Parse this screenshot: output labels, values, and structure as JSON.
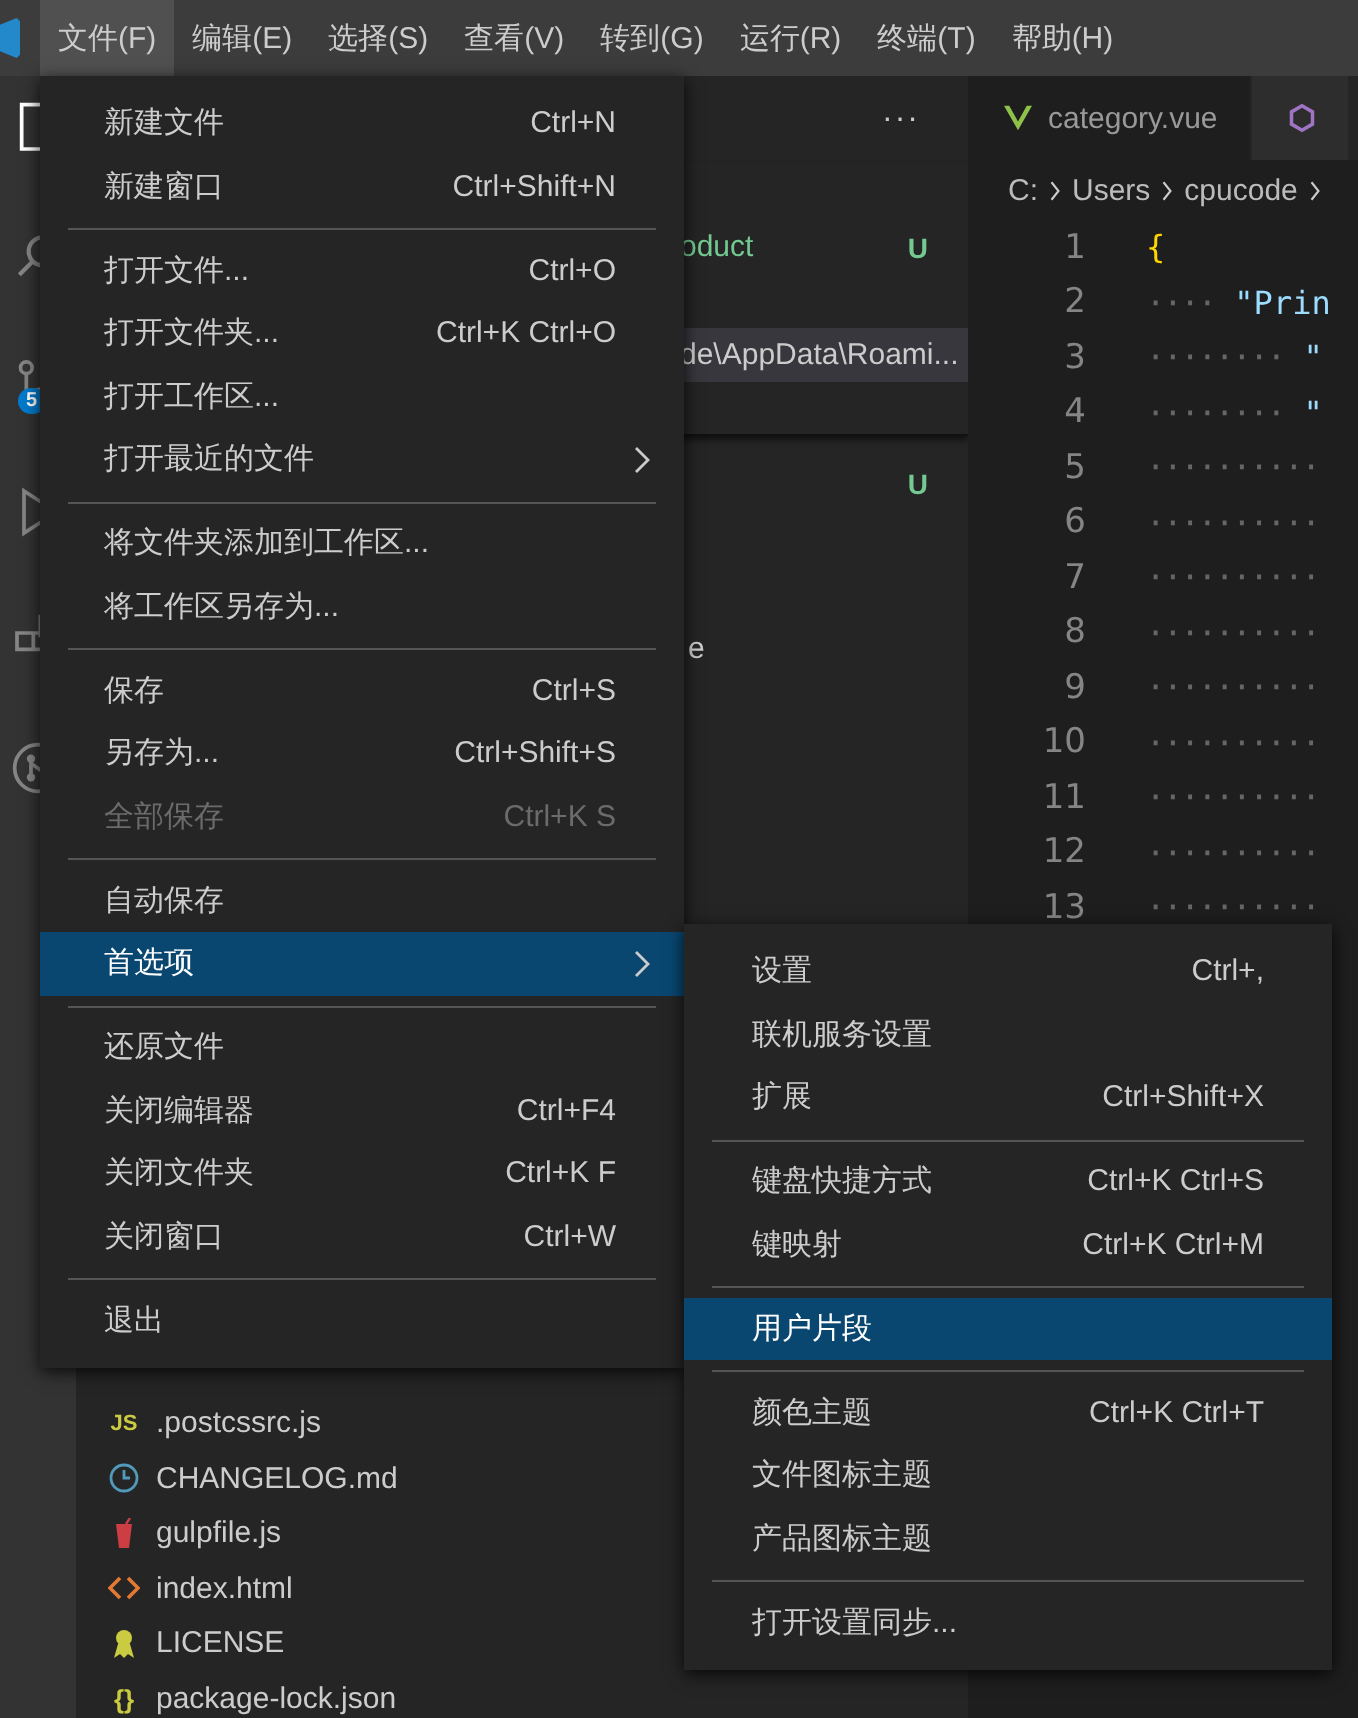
{
  "menubar": [
    {
      "label": "文件(F)",
      "selected": true
    },
    {
      "label": "编辑(E)",
      "selected": false
    },
    {
      "label": "选择(S)",
      "selected": false
    },
    {
      "label": "查看(V)",
      "selected": false
    },
    {
      "label": "转到(G)",
      "selected": false
    },
    {
      "label": "运行(R)",
      "selected": false
    },
    {
      "label": "终端(T)",
      "selected": false
    },
    {
      "label": "帮助(H)",
      "selected": false
    }
  ],
  "activity_bar": {
    "source_control_badge": "5"
  },
  "sidebar": {
    "more": "···",
    "open_editors": [
      {
        "text": "oduct",
        "status": "U",
        "selected": false
      },
      {
        "text": "de\\AppData\\Roami...",
        "selected": true
      }
    ],
    "folder_rows": [
      {
        "status": "U"
      },
      {
        "text": "e"
      }
    ],
    "files": [
      {
        "name": ".postcssrc.js",
        "kind": "js",
        "icon": "JS"
      },
      {
        "name": "CHANGELOG.md",
        "kind": "changelog"
      },
      {
        "name": "gulpfile.js",
        "kind": "gulp"
      },
      {
        "name": "index.html",
        "kind": "html"
      },
      {
        "name": "LICENSE",
        "kind": "license"
      },
      {
        "name": "package-lock.json",
        "kind": "json",
        "icon": "{}"
      }
    ]
  },
  "editor": {
    "tabs": [
      {
        "label": "category.vue",
        "kind": "vue",
        "selected": true
      },
      {
        "kind": "style",
        "selected": false
      }
    ],
    "breadcrumb": [
      "C:",
      "Users",
      "cpucode"
    ],
    "lines": [
      {
        "number": "1",
        "code": "{"
      },
      {
        "number": "2",
        "whitespace": "····",
        "code": "\"Prin"
      },
      {
        "number": "3",
        "whitespace": "········",
        "code": "\""
      },
      {
        "number": "4",
        "whitespace": "········",
        "code": "\""
      },
      {
        "number": "5",
        "whitespace": "··········"
      },
      {
        "number": "6",
        "whitespace": "··········"
      },
      {
        "number": "7",
        "whitespace": "··········"
      },
      {
        "number": "8",
        "whitespace": "··········"
      },
      {
        "number": "9",
        "whitespace": "··········"
      },
      {
        "number": "10",
        "whitespace": "··········"
      },
      {
        "number": "11",
        "whitespace": "··········"
      },
      {
        "number": "12",
        "whitespace": "··········"
      },
      {
        "number": "13",
        "whitespace": "··········"
      }
    ]
  },
  "file_menu": [
    {
      "kind": "item",
      "label": "新建文件",
      "shortcut": "Ctrl+N",
      "selected": false,
      "disabled": false
    },
    {
      "kind": "item",
      "label": "新建窗口",
      "shortcut": "Ctrl+Shift+N",
      "selected": false,
      "disabled": false
    },
    {
      "kind": "separator"
    },
    {
      "kind": "item",
      "label": "打开文件...",
      "shortcut": "Ctrl+O",
      "selected": false,
      "disabled": false
    },
    {
      "kind": "item",
      "label": "打开文件夹...",
      "shortcut": "Ctrl+K Ctrl+O",
      "selected": false,
      "disabled": false
    },
    {
      "kind": "item",
      "label": "打开工作区...",
      "selected": false,
      "disabled": false
    },
    {
      "kind": "submenu",
      "label": "打开最近的文件",
      "selected": false,
      "disabled": false
    },
    {
      "kind": "separator"
    },
    {
      "kind": "item",
      "label": "将文件夹添加到工作区...",
      "selected": false,
      "disabled": false
    },
    {
      "kind": "item",
      "label": "将工作区另存为...",
      "selected": false,
      "disabled": false
    },
    {
      "kind": "separator"
    },
    {
      "kind": "item",
      "label": "保存",
      "shortcut": "Ctrl+S",
      "selected": false,
      "disabled": false
    },
    {
      "kind": "item",
      "label": "另存为...",
      "shortcut": "Ctrl+Shift+S",
      "selected": false,
      "disabled": false
    },
    {
      "kind": "item",
      "label": "全部保存",
      "shortcut": "Ctrl+K S",
      "selected": false,
      "disabled": true
    },
    {
      "kind": "separator"
    },
    {
      "kind": "item",
      "label": "自动保存",
      "selected": false,
      "disabled": false
    },
    {
      "kind": "submenu",
      "label": "首选项",
      "selected": true,
      "disabled": false
    },
    {
      "kind": "separator"
    },
    {
      "kind": "item",
      "label": "还原文件",
      "selected": false,
      "disabled": false
    },
    {
      "kind": "item",
      "label": "关闭编辑器",
      "shortcut": "Ctrl+F4",
      "selected": false,
      "disabled": false
    },
    {
      "kind": "item",
      "label": "关闭文件夹",
      "shortcut": "Ctrl+K F",
      "selected": false,
      "disabled": false
    },
    {
      "kind": "item",
      "label": "关闭窗口",
      "shortcut": "Ctrl+W",
      "selected": false,
      "disabled": false
    },
    {
      "kind": "separator"
    },
    {
      "kind": "item",
      "label": "退出",
      "selected": false,
      "disabled": false
    }
  ],
  "preferences_submenu": [
    {
      "kind": "item",
      "label": "设置",
      "shortcut": "Ctrl+,",
      "selected": false,
      "disabled": false
    },
    {
      "kind": "item",
      "label": "联机服务设置",
      "selected": false,
      "disabled": false
    },
    {
      "kind": "item",
      "label": "扩展",
      "shortcut": "Ctrl+Shift+X",
      "selected": false,
      "disabled": false
    },
    {
      "kind": "separator"
    },
    {
      "kind": "item",
      "label": "键盘快捷方式",
      "shortcut": "Ctrl+K Ctrl+S",
      "selected": false,
      "disabled": false
    },
    {
      "kind": "item",
      "label": "键映射",
      "shortcut": "Ctrl+K Ctrl+M",
      "selected": false,
      "disabled": false
    },
    {
      "kind": "separator"
    },
    {
      "kind": "item",
      "label": "用户片段",
      "selected": true,
      "disabled": false
    },
    {
      "kind": "separator"
    },
    {
      "kind": "item",
      "label": "颜色主题",
      "shortcut": "Ctrl+K Ctrl+T",
      "selected": false,
      "disabled": false
    },
    {
      "kind": "item",
      "label": "文件图标主题",
      "selected": false,
      "disabled": false
    },
    {
      "kind": "item",
      "label": "产品图标主题",
      "selected": false,
      "disabled": false
    },
    {
      "kind": "separator"
    },
    {
      "kind": "item",
      "label": "打开设置同步...",
      "selected": false,
      "disabled": false
    }
  ]
}
